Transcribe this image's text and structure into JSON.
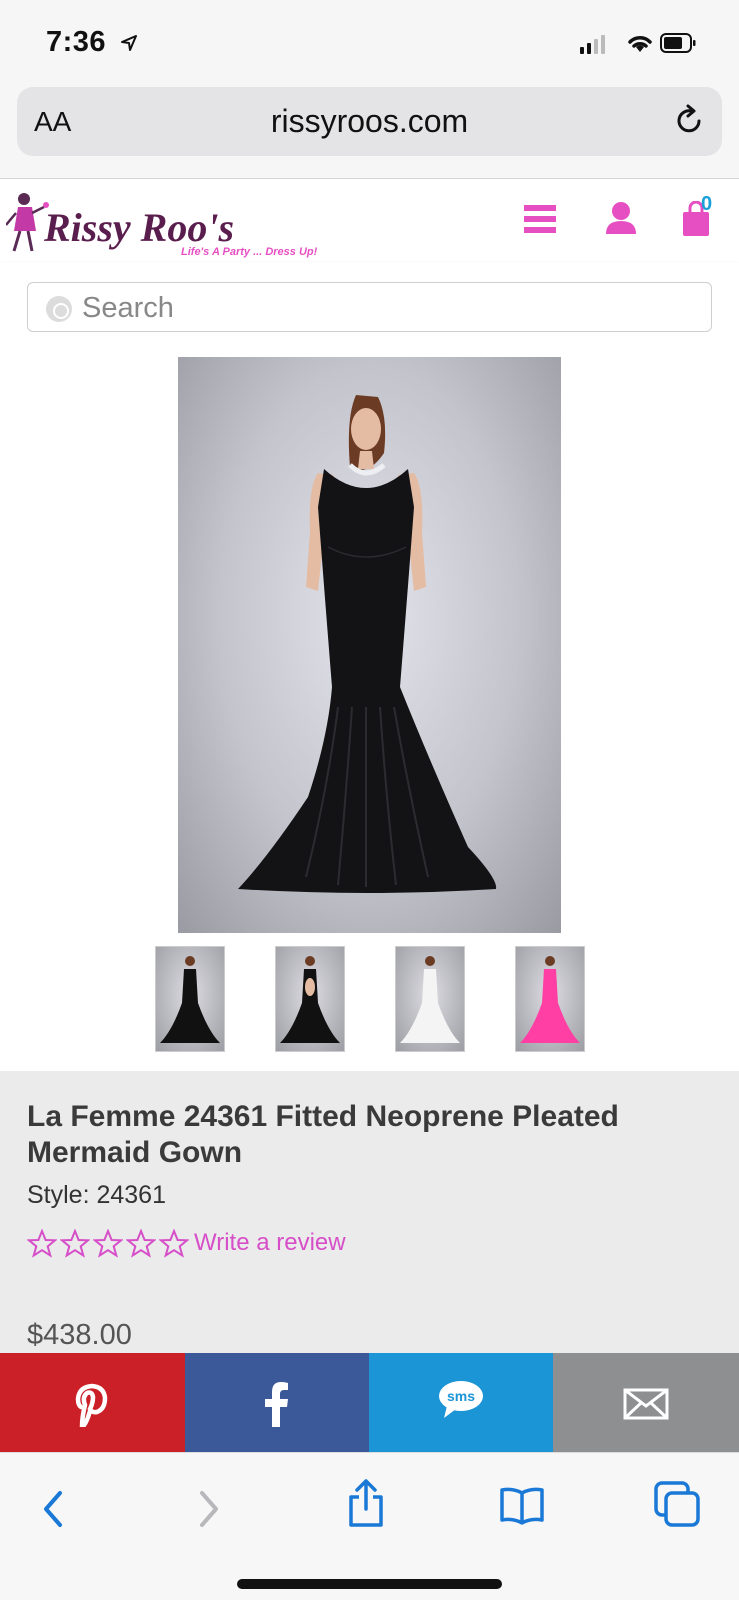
{
  "status_bar": {
    "time": "7:36"
  },
  "browser": {
    "aa_label": "AA",
    "domain": "rissyroos.com"
  },
  "site": {
    "logo_text": "Rissy Roo's",
    "logo_tagline": "Life's A Party ... Dress Up!",
    "cart_count": "0",
    "search_placeholder": "Search",
    "brand_color": "#e64fc2"
  },
  "product": {
    "title": "La Femme 24361 Fitted Neoprene Pleated Mermaid Gown",
    "style": "Style: 24361",
    "rating": 0,
    "rating_max": 5,
    "review_link": "Write a review",
    "price": "$438.00",
    "thumbnails": [
      {
        "name": "thumb-black-front",
        "dress_color": "#111111"
      },
      {
        "name": "thumb-black-back",
        "dress_color": "#111111"
      },
      {
        "name": "thumb-white-front",
        "dress_color": "#f4f4f4"
      },
      {
        "name": "thumb-pink-front",
        "dress_color": "#ff3fa4"
      }
    ]
  },
  "share": [
    {
      "name": "pinterest-share-button",
      "icon": "pinterest-icon",
      "color": "#cb2027"
    },
    {
      "name": "facebook-share-button",
      "icon": "facebook-icon",
      "color": "#3b5998"
    },
    {
      "name": "sms-share-button",
      "icon": "sms-icon",
      "color": "#1b95d6",
      "label": "sms"
    },
    {
      "name": "email-share-button",
      "icon": "envelope-icon",
      "color": "#8e8f91"
    }
  ]
}
